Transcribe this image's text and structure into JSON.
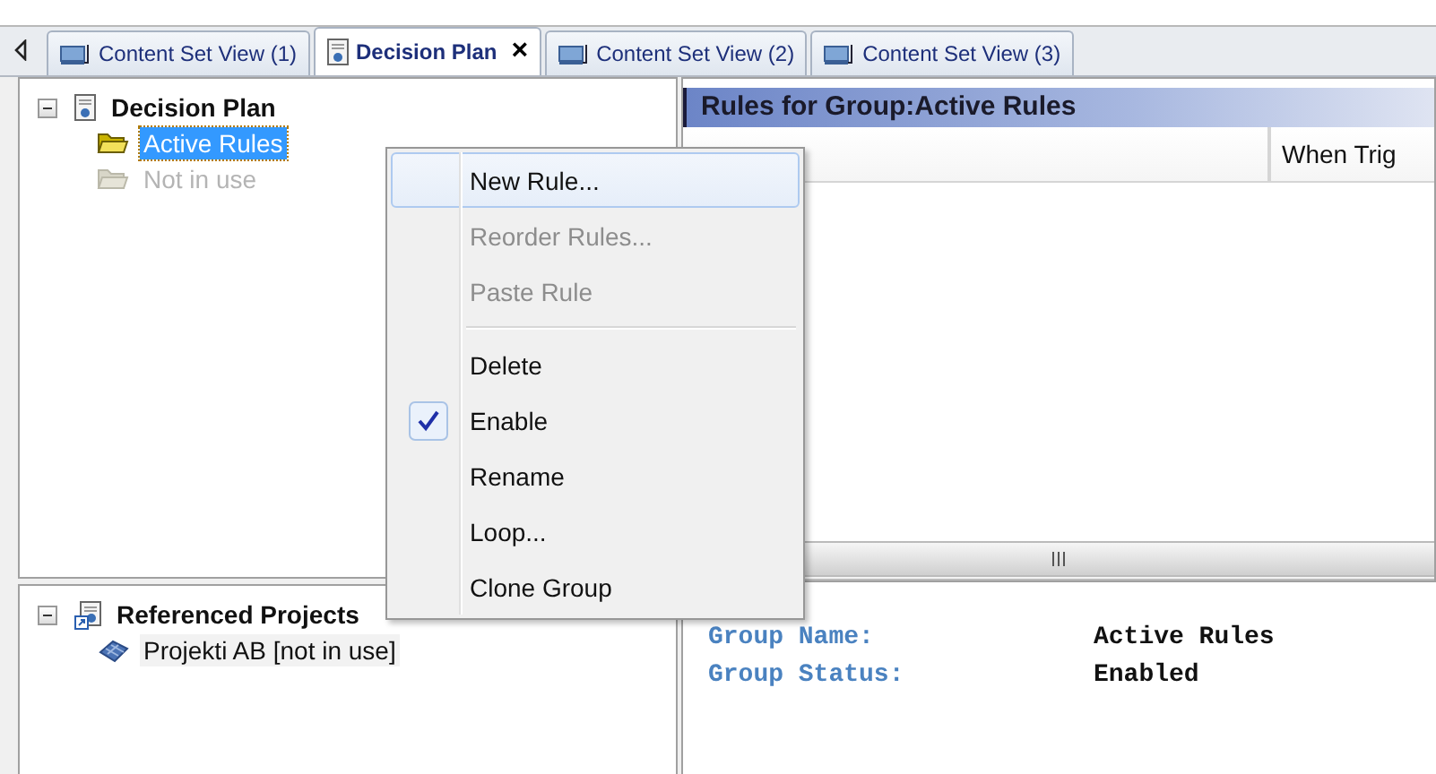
{
  "tabs": [
    {
      "label": "Content Set View (1)",
      "kind": "view",
      "selected": false
    },
    {
      "label": "Decision Plan",
      "kind": "plan",
      "selected": true,
      "close": "×"
    },
    {
      "label": "Content Set View (2)",
      "kind": "view",
      "selected": false
    },
    {
      "label": "Content Set View (3)",
      "kind": "view",
      "selected": false
    }
  ],
  "plan_tree": [
    {
      "label": "Decision Plan",
      "expanded": true,
      "children": [
        {
          "label": "Active Rules",
          "selected": true,
          "disabled": false
        },
        {
          "label": "Not in use",
          "selected": false,
          "disabled": true
        }
      ]
    }
  ],
  "projects_tree": [
    {
      "label": "Referenced Projects",
      "expanded": true,
      "children": [
        {
          "label": "Projekti AB [not in use]",
          "selected": false,
          "disabled": false
        }
      ]
    }
  ],
  "rules_panel": {
    "title": "Rules for Group:Active Rules",
    "columns": [
      "When Trig"
    ]
  },
  "details": [
    {
      "label": "Group Name:",
      "value": "Active Rules"
    },
    {
      "label": "Group Status:",
      "value": "Enabled"
    }
  ],
  "context_menu": [
    {
      "kind": "item",
      "label": "New Rule...",
      "disabled": false,
      "checked": false,
      "selected": true
    },
    {
      "kind": "item",
      "label": "Reorder Rules...",
      "disabled": true,
      "checked": false,
      "selected": false
    },
    {
      "kind": "item",
      "label": "Paste Rule",
      "disabled": true,
      "checked": false,
      "selected": false
    },
    {
      "kind": "separator"
    },
    {
      "kind": "item",
      "label": "Delete",
      "disabled": false,
      "checked": false,
      "selected": false
    },
    {
      "kind": "item",
      "label": "Enable",
      "disabled": false,
      "checked": true,
      "selected": false
    },
    {
      "kind": "item",
      "label": "Rename",
      "disabled": false,
      "checked": false,
      "selected": false
    },
    {
      "kind": "item",
      "label": "Loop...",
      "disabled": false,
      "checked": false,
      "selected": false
    },
    {
      "kind": "item",
      "label": "Clone Group",
      "disabled": false,
      "checked": false,
      "selected": false
    }
  ]
}
